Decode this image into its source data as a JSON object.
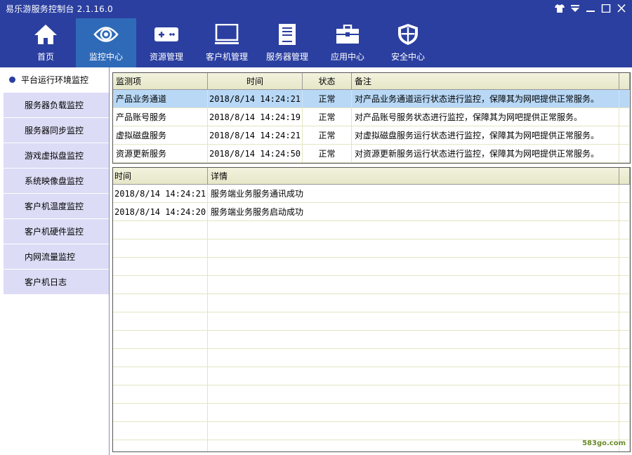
{
  "app": {
    "title": "易乐游服务控制台 2.1.16.0"
  },
  "nav": [
    {
      "id": "home",
      "label": "首页",
      "icon": "home-icon",
      "active": false
    },
    {
      "id": "monitor",
      "label": "监控中心",
      "icon": "eye-icon",
      "active": true
    },
    {
      "id": "resource",
      "label": "资源管理",
      "icon": "gamepad-icon",
      "active": false
    },
    {
      "id": "client",
      "label": "客户机管理",
      "icon": "monitor-icon",
      "active": false
    },
    {
      "id": "server",
      "label": "服务器管理",
      "icon": "server-icon",
      "active": false
    },
    {
      "id": "apps",
      "label": "应用中心",
      "icon": "toolbox-icon",
      "active": false
    },
    {
      "id": "security",
      "label": "安全中心",
      "icon": "shield-icon",
      "active": false
    }
  ],
  "sidebar": {
    "items": [
      {
        "label": "平台运行环境监控",
        "active": true
      },
      {
        "label": "服务器负载监控",
        "active": false
      },
      {
        "label": "服务器同步监控",
        "active": false
      },
      {
        "label": "游戏虚拟盘监控",
        "active": false
      },
      {
        "label": "系统映像盘监控",
        "active": false
      },
      {
        "label": "客户机温度监控",
        "active": false
      },
      {
        "label": "客户机硬件监控",
        "active": false
      },
      {
        "label": "内网流量监控",
        "active": false
      },
      {
        "label": "客户机日志",
        "active": false
      }
    ]
  },
  "monitor_table": {
    "headers": [
      "监测项",
      "时间",
      "状态",
      "备注"
    ],
    "rows": [
      {
        "item": "产品业务通道",
        "time": "2018/8/14 14:24:21",
        "status": "正常",
        "note": "对产品业务通道运行状态进行监控，保障其为网吧提供正常服务。",
        "selected": true
      },
      {
        "item": "产品账号服务",
        "time": "2018/8/14 14:24:19",
        "status": "正常",
        "note": "对产品账号服务状态进行监控，保障其为网吧提供正常服务。",
        "selected": false
      },
      {
        "item": "虚拟磁盘服务",
        "time": "2018/8/14 14:24:21",
        "status": "正常",
        "note": "对虚拟磁盘服务运行状态进行监控，保障其为网吧提供正常服务。",
        "selected": false
      },
      {
        "item": "资源更新服务",
        "time": "2018/8/14 14:24:50",
        "status": "正常",
        "note": "对资源更新服务运行状态进行监控，保障其为网吧提供正常服务。",
        "selected": false
      }
    ]
  },
  "log_table": {
    "headers": [
      "时间",
      "详情"
    ],
    "rows": [
      {
        "time": "2018/8/14 14:24:21",
        "detail": "服务端业务服务通讯成功"
      },
      {
        "time": "2018/8/14 14:24:20",
        "detail": "服务端业务服务启动成功"
      }
    ],
    "empty_rows": 13
  },
  "watermark": "583go.com",
  "colors": {
    "topbar": "#2b3fa0",
    "active_nav": "#2f6ab8",
    "sidebar_item": "#dcdcf6",
    "selected_row": "#b8d8f6"
  }
}
